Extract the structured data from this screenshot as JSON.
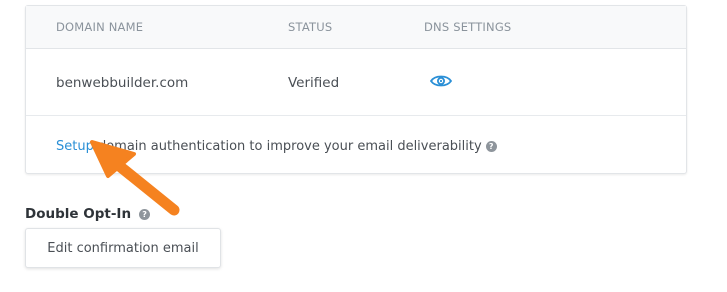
{
  "domains_table": {
    "headers": [
      "DOMAIN NAME",
      "STATUS",
      "DNS SETTINGS"
    ],
    "rows": [
      {
        "domain": "benwebbuilder.com",
        "status": "Verified",
        "dns_icon": "eye-icon"
      }
    ],
    "auth_link": "Setup",
    "auth_text": " domain authentication to improve your email deliverability",
    "help_glyph": "?"
  },
  "double_opt_in": {
    "title": "Double Opt-In",
    "help_glyph": "?",
    "button_label": "Edit confirmation email"
  },
  "annotation": {
    "arrow_color": "#f58220",
    "icon": "arrow-icon"
  },
  "colors": {
    "link": "#2a8fd6",
    "accent": "#f58220"
  }
}
